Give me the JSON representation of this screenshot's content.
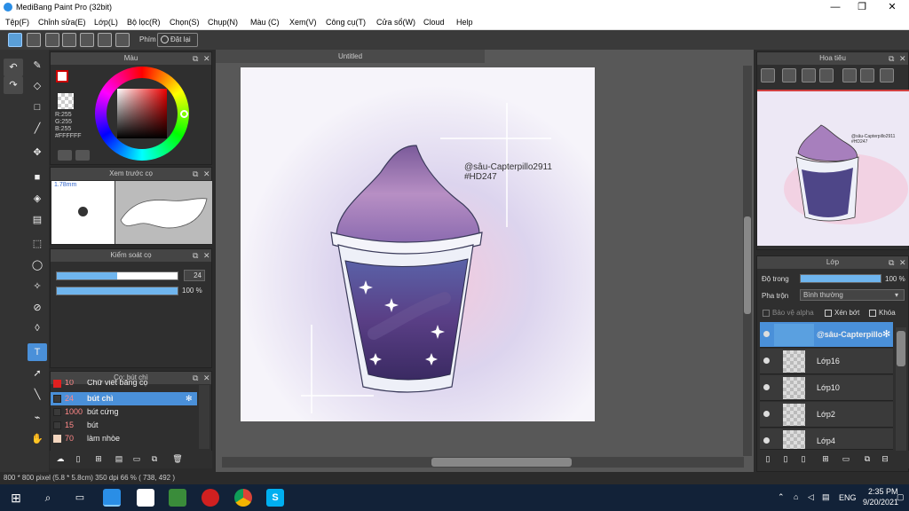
{
  "window": {
    "title": "MediBang Paint Pro (32bit)",
    "minimize": "—",
    "maximize": "❐",
    "close": "✕"
  },
  "menu": [
    "Tệp(F)",
    "Chỉnh sửa(E)",
    "Lớp(L)",
    "Bộ lọc(R)",
    "Chọn(S)",
    "Chụp(N)",
    "Màu (C)",
    "Xem(V)",
    "Công cụ(T)",
    "Cửa sổ(W)",
    "Cloud",
    "Help"
  ],
  "toolbar": {
    "key_label": "Phím",
    "reset_label": "Đặt lại"
  },
  "color_panel": {
    "title": "Màu",
    "rgb": "R:255\nG:255\nB:255\n#FFFFFF"
  },
  "brush_preview": {
    "title": "Xem trước cọ",
    "size": "1.78mm"
  },
  "control_panel": {
    "title": "Kiểm soát cọ",
    "size_value": "24",
    "opacity_value": "100 %",
    "size_fill": 0.5,
    "opacity_fill": 1.0
  },
  "brush_panel": {
    "title": "Cọ: bút chì",
    "items": [
      {
        "size": "10",
        "name": "Chữ viết bằng cọ",
        "color": "#e02020"
      },
      {
        "size": "24",
        "name": "bút chì",
        "color": "#3a3a3a",
        "selected": true
      },
      {
        "size": "1000",
        "name": "bút cứng",
        "color": "#3a3a3a"
      },
      {
        "size": "15",
        "name": "bút",
        "color": "#3a3a3a"
      },
      {
        "size": "70",
        "name": "làm nhòe",
        "color": "#f5d7c0"
      }
    ]
  },
  "canvas": {
    "tab": "Untitled",
    "watermark_line1": "@sâu-Capterpillo2911",
    "watermark_line2": "#HD247"
  },
  "navigator": {
    "title": "Hoa tiêu",
    "wm1": "@sâu-Capterpillo2911",
    "wm2": "#HD247"
  },
  "layers_panel": {
    "title": "Lớp",
    "opacity_label": "Độ trong",
    "opacity_value": "100 %",
    "opacity_fill": 1.0,
    "blend_label": "Pha trộn",
    "blend_value": "Bình thường",
    "protect_alpha": "Bảo vệ alpha",
    "clipping": "Xén bớt",
    "lock": "Khóa",
    "layers": [
      {
        "name": "@sâu-Capterpillo",
        "selected": true
      },
      {
        "name": "Lớp16"
      },
      {
        "name": "Lớp10"
      },
      {
        "name": "Lớp2"
      },
      {
        "name": "Lớp4"
      }
    ]
  },
  "status": "800 * 800 pixel   (5.8 * 5.8cm)   350 dpi   66 %   ( 738, 492 )",
  "taskbar": {
    "lang": "ENG",
    "time": "2:35 PM",
    "date": "9/20/2021"
  },
  "colors": {
    "accent": "#4a90d9",
    "title_bg": "#ffffff",
    "panel_bg": "#2f2f2f",
    "taskbar_bg": "#122238"
  }
}
